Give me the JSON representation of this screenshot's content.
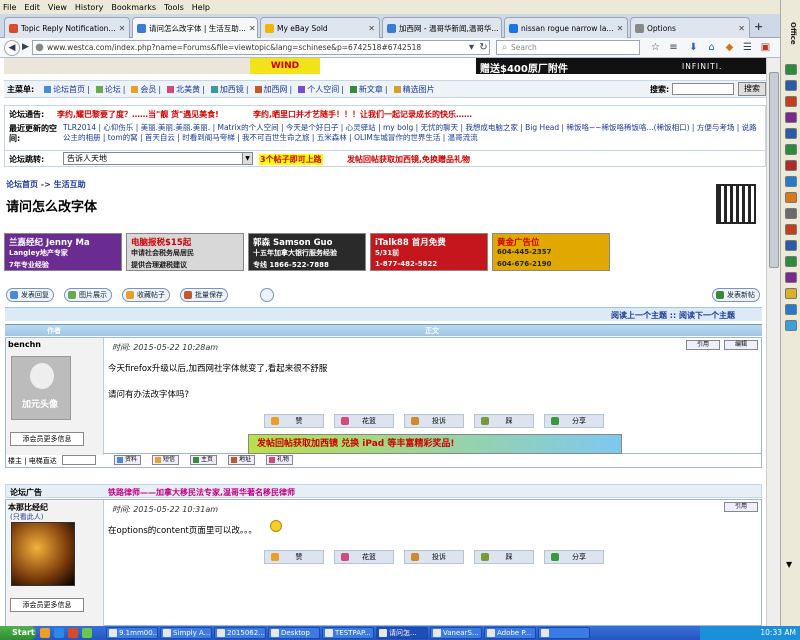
{
  "menubar": [
    "File",
    "Edit",
    "View",
    "History",
    "Bookmarks",
    "Tools",
    "Help"
  ],
  "tabs": [
    {
      "label": "Topic Reply Notification...",
      "color": "#d94a2a",
      "active": false
    },
    {
      "label": "请问怎么改字体 | 生活互助...",
      "color": "#3a7bd5",
      "active": true
    },
    {
      "label": "My eBay Sold",
      "color": "#f4b400",
      "active": false
    },
    {
      "label": "加西网 - 温哥华新闻,温哥华...",
      "color": "#3a7bd5",
      "active": false
    },
    {
      "label": "nissan rogue narrow la...",
      "color": "#1a73e8",
      "active": false
    },
    {
      "label": "Options",
      "color": "#888888",
      "active": false
    }
  ],
  "new_tab": "+",
  "nav": {
    "url": "www.westca.com/index.php?name=Forums&file=viewtopic&lang=schinese&p=6742518#6742518",
    "search_placeholder": "Search"
  },
  "site": {
    "top_ad_right": "赠送$400原厂附件",
    "top_ad_brand": "INFINITI.",
    "top_ad_left": "WIND",
    "menu_label": "主菜单:",
    "menu_items": [
      "论坛首页",
      "论坛",
      "会员",
      "北美黄",
      "加西镜",
      "加西网",
      "个人空间",
      "新文章",
      "精选图片"
    ],
    "search_label": "搜索:",
    "search_button": "搜索",
    "notice_label": "论坛通告:",
    "notice_1": "李约,耀巴黎要了度？……当\"靓 货\"遇见美食!",
    "notice_2": "李约,晒里口并才艺随手！！！让我们一起记录成长的快乐……",
    "recent_label": "最近更新的空间:",
    "recent_links": "TLR2014 | 心仰伤乐 | 美丽.美丽.美丽.美丽. | Matrix的个人空间 | 今天是个好日子 | 心灵驿站 | my bolg | 无忧的聊天 | 我想成电脑之家 | Big Head | 稀饭咯~~稀饭咯稀饭咯...(稀饭相口) | 方便与考场 | 说路公主的相册 | tom的窝 | 首天自云 | 时看到阁马夸梯 | 我不可百世生命之旅 | 五米森林 | OLIM车城冒作的世界生活 | 温哥流流",
    "jump_label": "论坛跳转:",
    "jump_value": "告诉人天地",
    "jump_note_1": "3个帖子即可上路",
    "jump_note_2": "发帖回帖获取加西镜,免换赠品礼物",
    "breadcrumb_home": "论坛首页",
    "breadcrumb_arrow": "->",
    "breadcrumb_section": "生活互助",
    "topic_title": "请问怎么改字体",
    "banners": [
      {
        "line1": "兰嘉经纪 Jenny Ma",
        "line2": "Langley地产专家",
        "line3": "7年专业经验",
        "bg": "#6a2c91"
      },
      {
        "line1": "电脑报税$15起",
        "line2": "申请社会税务局居民",
        "line3": "提供合理避税建议",
        "bg": "#d8d8d8"
      },
      {
        "line1": "郭森 Samson Guo",
        "line2": "十五年加拿大银行服务经验",
        "line3": "专线 1866-522-7888",
        "bg": "#2a2a2a"
      },
      {
        "line1": "iTalk88 首月免费",
        "line2": "5/31前",
        "line3": "1-877-482-5822",
        "bg": "#c4161c"
      },
      {
        "line1": "黄金广告位",
        "line2": "604-445-2357",
        "line3": "604-676-2190",
        "bg": "#e0a800"
      }
    ],
    "post_buttons": [
      "发表回复",
      "图片展示",
      "收藏帖子",
      "批量保存"
    ],
    "new_topic_button": "发表新帖",
    "nav_topics": "阅读上一个主题 :: 阅读下一个主题",
    "col_author": "作者",
    "col_body": "正文",
    "post1": {
      "author": "benchn",
      "time": "时间: 2015-05-22 10:28am",
      "line1": "今天firefox升级以后,加西网社字体就变了,看起来很不舒服",
      "line2": "请问有办法改字体吗?",
      "avatar_caption": "加元头像",
      "more_info": "添会员更多信息",
      "quote": "引用",
      "edit": "编辑",
      "actions": [
        "赞",
        "花篮",
        "投诉",
        "踩",
        "分享"
      ],
      "promo_text": "发帖回帖获取加西镜 兑换 iPad 等丰富精彩奖品!",
      "foot_label": "楼主 | 电梯直达",
      "foot_buttons": [
        "资料",
        "短信",
        "主页",
        "地址",
        "礼物"
      ]
    },
    "ad_label": "论坛广告",
    "ad_text": "铁路律师——加拿大移民法专家,温哥华著名移民律师",
    "post2": {
      "author": "本那比经纪",
      "role": "(只看此人)",
      "time": "时间: 2015-05-22 10:31am",
      "quote": "引用",
      "line1": "在options的content页面里可以改。。。",
      "more_info": "添会员更多信息",
      "actions": [
        "赞",
        "花篮",
        "投诉",
        "踩",
        "分享"
      ]
    }
  },
  "taskbar": {
    "start": "Start",
    "tasks": [
      "9.1mm00...",
      "Simply A...",
      "2015062...",
      "Desktop",
      "TESTPAP...",
      "请问怎...",
      "VanearS...",
      "Adobe P...",
      " "
    ],
    "clock": "10:33 AM"
  }
}
